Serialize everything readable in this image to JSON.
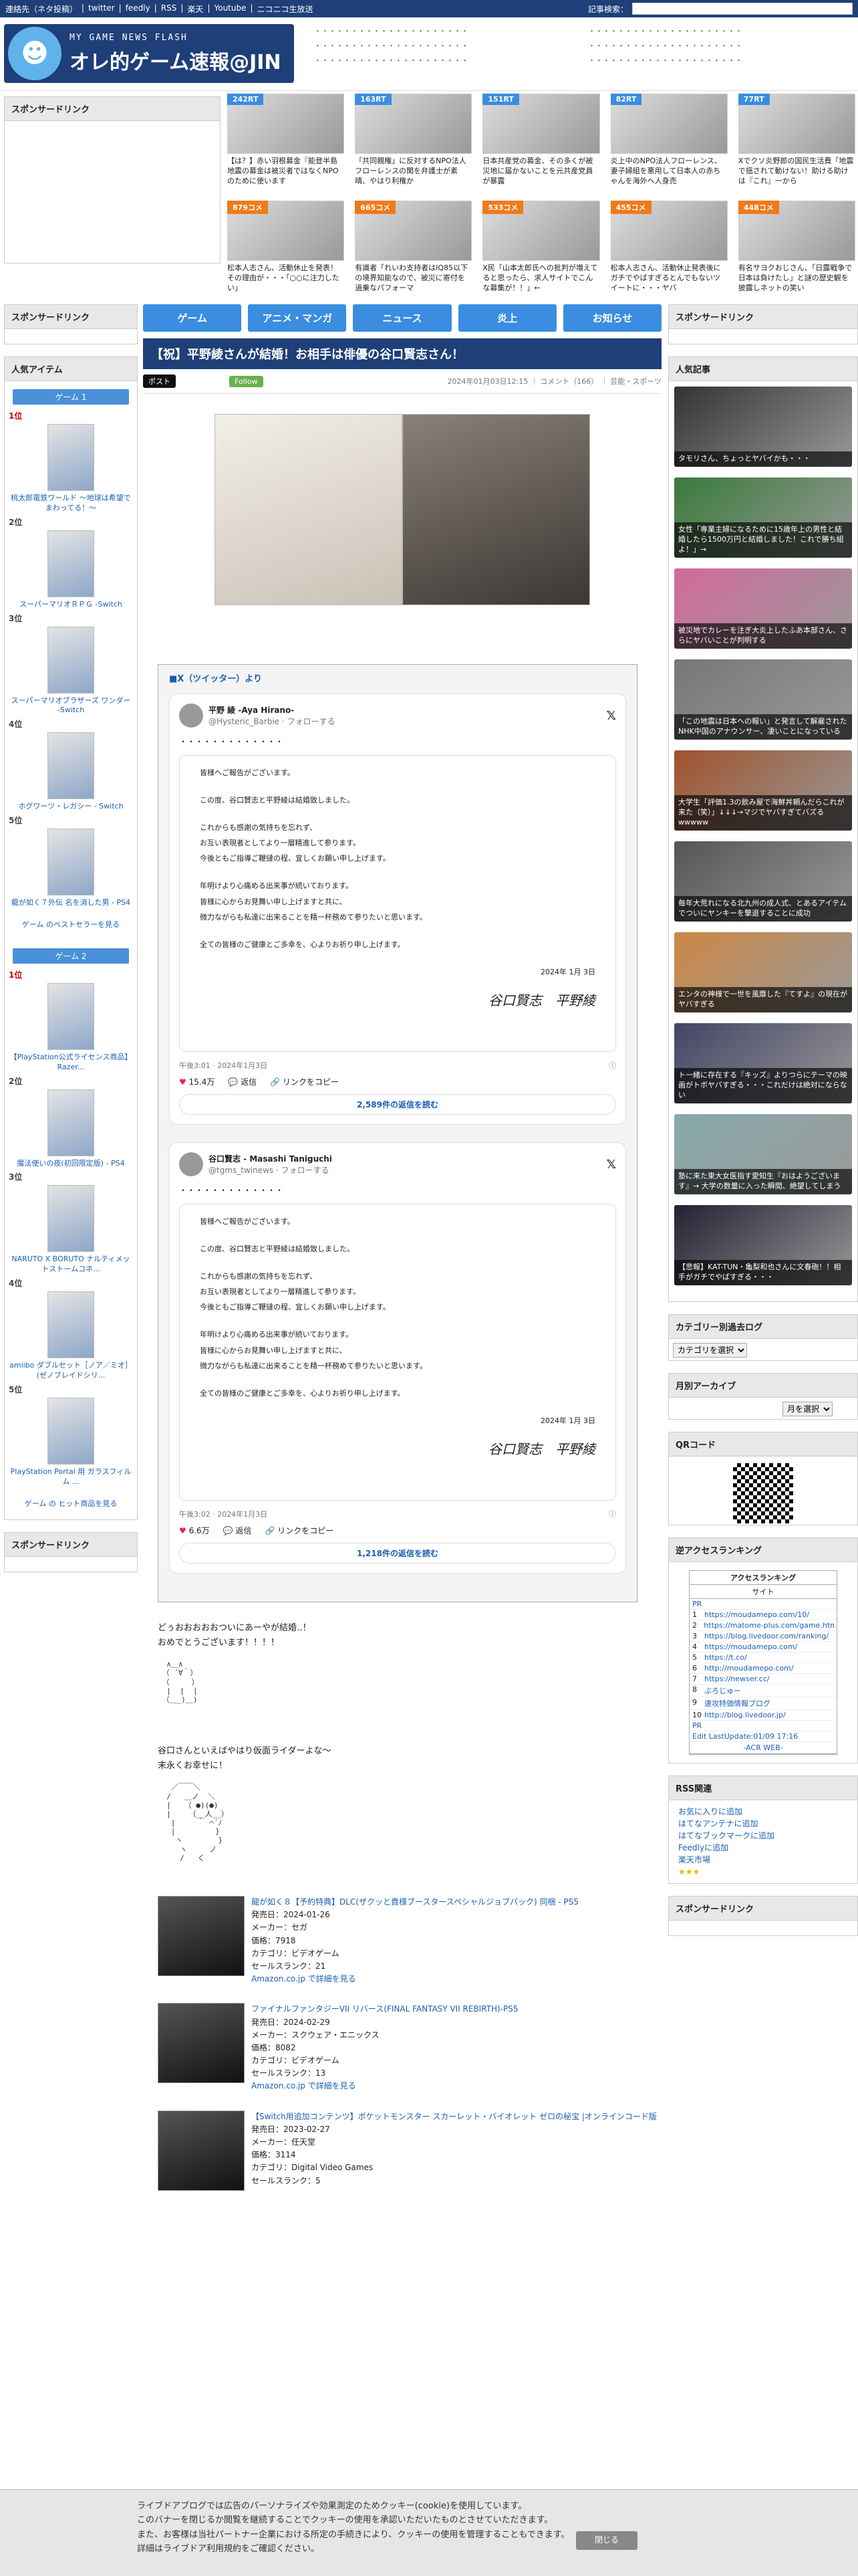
{
  "topbar": {
    "links": [
      "連絡先（ネタ投稿）",
      "twitter",
      "feedly",
      "RSS",
      "楽天",
      "Youtube",
      "ニコニコ生放送"
    ],
    "search_label": "記事検索：",
    "search_placeholder": ""
  },
  "header": {
    "logo_sub": "MY GAME NEWS FLASH",
    "logo_main": "オレ的ゲーム速報@JIN",
    "links": [
      "・・・・・・・・・・・・・・・・・・・・・",
      "・・・・・・・・・・・・・・・・・・・・・",
      "・・・・・・・・・・・・・・・・・・・・・",
      "・・・・・・・・・・・・・・・・・・・・・",
      "・・・・・・・・・・・・・・・・・・・・・",
      "・・・・・・・・・・・・・・・・・・・・・"
    ]
  },
  "sponsor_label": "スポンサードリンク",
  "headlines": [
    {
      "badge": "242RT",
      "kind": "rt",
      "caption": "【は？】赤い羽根募金『能登半島地震の募金は被災者ではなくNPOのために使います"
    },
    {
      "badge": "163RT",
      "kind": "rt",
      "caption": "「共同親権」に反対するNPO法人フローレンスの関を弁護士が素晴、やはり利権か"
    },
    {
      "badge": "151RT",
      "kind": "rt",
      "caption": "日本共産党の募金、その多くが被災地に届かないことを元共産党員が暴露"
    },
    {
      "badge": "82RT",
      "kind": "rt",
      "caption": "炎上中のNPO法人フローレンス、妻子婦組を悪用して日本人の赤ちゃんを海外へ人身売"
    },
    {
      "badge": "77RT",
      "kind": "rt",
      "caption": "Xでクソ炎野郎の国民生活費「地震で揺されて動けない！助ける助けは『これ』一から"
    },
    {
      "badge": "879コメ",
      "kind": "cm",
      "caption": "松本人志さん、活動休止を発表！その理由が・・・「○○に注力したい」"
    },
    {
      "badge": "665コメ",
      "kind": "cm",
      "caption": "有識者「れいわ支持者はIQ85以下の境界知能なので、被災に寄付を過乗なパフォーマ"
    },
    {
      "badge": "533コメ",
      "kind": "cm",
      "caption": "X民「山本太郎氏への批判が増えてると思ったら、求人サイトでこんな募集が！！」←"
    },
    {
      "badge": "455コメ",
      "kind": "cm",
      "caption": "松本人志さん、活動休止発表後にガチでやばすぎるとんでもないツイートに・・・ヤバ"
    },
    {
      "badge": "448コメ",
      "kind": "cm",
      "caption": "有名サヨクおじさん、「日露戦争で日本は負けたし」と謎の歴史観を披露しネットの笑い"
    }
  ],
  "left": {
    "sponsor": "スポンサードリンク",
    "popular_title": "人気アイテム",
    "game1_label": "ゲーム 1",
    "game1": [
      {
        "rank": "1位",
        "name": "桃太郎電鉄ワールド ～地球は希望でまわってる！～"
      },
      {
        "rank": "2位",
        "name": "スーパーマリオＲＰＧ -Switch"
      },
      {
        "rank": "3位",
        "name": "スーパーマリオブラザーズ ワンダー -Switch"
      },
      {
        "rank": "4位",
        "name": "ホグワーツ・レガシー - Switch"
      },
      {
        "rank": "5位",
        "name": "龍が如く７外伝 名を消した男 - PS4"
      }
    ],
    "game1_more": "ゲーム のベストセラーを見る",
    "game2_label": "ゲーム 2",
    "game2": [
      {
        "rank": "1位",
        "name": "【PlayStation公式ライセンス商品】 Razer..."
      },
      {
        "rank": "2位",
        "name": "魔法使いの夜(初回限定版) - PS4"
      },
      {
        "rank": "3位",
        "name": "NARUTO X BORUTO ナルティメットストームコネ..."
      },
      {
        "rank": "4位",
        "name": "amiibo ダブルセット［ノア／ミオ］(ゼノブレイドシリ..."
      },
      {
        "rank": "5位",
        "name": "PlayStation Portal 用 ガラスフィルム ..."
      }
    ],
    "game2_more": "ゲーム の ヒット商品を見る",
    "sponsor2": "スポンサードリンク"
  },
  "nav": [
    "ゲーム",
    "アニメ・マンガ",
    "ニュース",
    "炎上",
    "お知らせ"
  ],
  "article": {
    "title": "【祝】平野綾さんが結婚！お相手は俳優の谷口賢志さん！",
    "tweet_btn": "ポスト",
    "follow_btn": "Follow",
    "meta": "2024年01月03日12:15 ｜ コメント（166） ｜ 芸能・スポーツ",
    "x_header": "■X（ツイッター）より",
    "tweets": [
      {
        "name": "平野 綾 -Aya Hirano-",
        "handle": "@Hysteric_Barbie · フォローする",
        "body": "・・・・・・・・・・・・・",
        "letter": [
          "皆様へご報告がございます。",
          "この度、谷口賢志と平野綾は結婚致しました。",
          "これからも感謝の気持ちを忘れず、",
          "お互い表現者としてより一層精進して参ります。",
          "今後ともご指導ご鞭撻の程、宜しくお願い申し上げます。",
          "年明けより心痛める出来事が続いております。",
          "皆様に心からお見舞い申し上げますと共に、",
          "微力ながらも私達に出来ることを精一杯務めて参りたいと思います。",
          "全ての皆様のご健康とご多幸を、心よりお祈り申し上げます。"
        ],
        "date": "2024年 1月 3日",
        "sig": "谷口賢志　平野綾",
        "time": "午後3:01 · 2024年1月3日",
        "likes": "15.4万",
        "reply": "返信",
        "share": "リンクをコピー",
        "more": "2,589件の返信を読む"
      },
      {
        "name": "谷口賢志 - Masashi Taniguchi",
        "handle": "@tgms_twinews · フォローする",
        "body": "・・・・・・・・・・・・・",
        "letter": [
          "皆様へご報告がございます。",
          "この度、谷口賢志と平野綾は結婚致しました。",
          "これからも感謝の気持ちを忘れず、",
          "お互い表現者としてより一層精進して参ります。",
          "今後ともご指導ご鞭撻の程、宜しくお願い申し上げます。",
          "年明けより心痛める出来事が続いております。",
          "皆様に心からお見舞い申し上げますと共に、",
          "微力ながらも私達に出来ることを精一杯務めて参りたいと思います。",
          "全ての皆様のご健康とご多幸を、心よりお祈り申し上げます。"
        ],
        "date": "2024年 1月 3日",
        "sig": "谷口賢志　平野綾",
        "time": "午後3:02 · 2024年1月3日",
        "likes": "6.6万",
        "reply": "返信",
        "share": "リンクをコピー",
        "more": "1,218件の返信を読む"
      }
    ],
    "comment1a": "どぅおおおおおついにあーやが結婚‥！",
    "comment1b": "おめでとうございます！！！！",
    "comment2a": "谷口さんといえばやはり仮面ライダーよな～",
    "comment2b": "末永くお幸せに！"
  },
  "products": [
    {
      "title": "龍が如く８【予約特典】DLC(ザクッと貴様ブースタースペシャルジョブパック) 同梱 - PS5",
      "lines": [
        "発売日：2024-01-26",
        "メーカー：セガ",
        "価格：7918",
        "カテゴリ：ビデオゲーム",
        "セールスランク：21"
      ],
      "link": "Amazon.co.jp で詳細を見る"
    },
    {
      "title": "ファイナルファンタジーVII リバース(FINAL FANTASY VII REBIRTH)-PS5",
      "lines": [
        "発売日：2024-02-29",
        "メーカー：スクウェア・エニックス",
        "価格：8082",
        "カテゴリ：ビデオゲーム",
        "セールスランク：13"
      ],
      "link": "Amazon.co.jp で詳細を見る"
    },
    {
      "title": "【Switch用追加コンテンツ】ポケットモンスター スカーレット・バイオレット ゼロの秘宝 |オンラインコード版",
      "lines": [
        "発売日：2023-02-27",
        "メーカー：任天堂",
        "価格：3114",
        "カテゴリ：Digital Video Games",
        "セールスランク：5"
      ],
      "link": ""
    }
  ],
  "right": {
    "sponsor": "スポンサードリンク",
    "popular_title": "人気記事",
    "popular": [
      "タモリさん、ちょっとヤバイかも・・・",
      "女性「専業主婦になるために15歳年上の男性と結婚したら1500万円と結婚しました！これで勝ち組よ！」→",
      "被災地でカレーを注ぎ大炎上したふあ本部さん、さらにヤバいことが判明する",
      "「この地震は日本への報い」と発言して解雇されたNHK中国のアナウンサー、凄いことになっている",
      "大学生「評価1.3の飲み屋で海鮮丼頼んだらこれが来た（笑）」↓↓↓→マジでヤバすぎてバズるwwwww",
      "毎年大荒れになる北九州の成人式、とあるアイテムでついにヤンキーを撃退することに成功",
      "エンタの神様で一世を風靡した『てすよ』の現在がヤバすぎる",
      "ト一緒に存在する『キッズ』よりつらにテーマの映画がトボヤバすぎる・・・これだけは絶対にならない",
      "塾に来た東大女医指す愛知生『おはようございます』→ 大学の数量に入った瞬間、絶望してしまう",
      "【悲報】KAT-TUN・亀梨和也さんに文春砲！！相手がガチでやばすぎる・・・"
    ],
    "category_title": "カテゴリー別過去ログ",
    "category_select": "カテゴリを選択",
    "monthly_title": "月別アーカイブ",
    "monthly_select": "月を選択",
    "qr_title": "QRコード",
    "ranking_title": "逆アクセスランキング",
    "acr_header": "アクセスランキング",
    "acr_sub": "サイト",
    "acr_pr": "PR",
    "acr_rows": [
      "https://moudamepo.com/10/",
      "https://matome-plus.com/game.html",
      "https://blog.livedoor.com/ranking/",
      "https://moudamepo.com/",
      "https://t.co/",
      "http://moudamepo.com/",
      "https://newser.cc/",
      "ぶろじゅー",
      "速攻特価情報ブログ",
      "http://blog.livedoor.jp/"
    ],
    "acr_update": "Edit LastUpdate:01/09 17:16",
    "acr_foot": "-ACR WEB-",
    "rss_title": "RSS関連",
    "rss_links": [
      "お気に入りに追加",
      "はてなアンテナに追加",
      "はてなブックマークに追加",
      "Feedlyに追加",
      "楽天市場"
    ],
    "stars": "★★★",
    "sponsor2": "スポンサードリンク"
  },
  "cookie": {
    "line1": "ライブドアブログでは広告のパーソナライズや効果測定のためクッキー(cookie)を使用しています。",
    "line2": "このバナーを閉じるか閲覧を継続することでクッキーの使用を承認いただいたものとさせていただきます。",
    "line3": "また、お客様は当社パートナー企業における所定の手続きにより、クッキーの使用を管理することもできます。",
    "line4": "詳細はライブドア利用規約をご確認ください。",
    "close": "閉じる"
  }
}
